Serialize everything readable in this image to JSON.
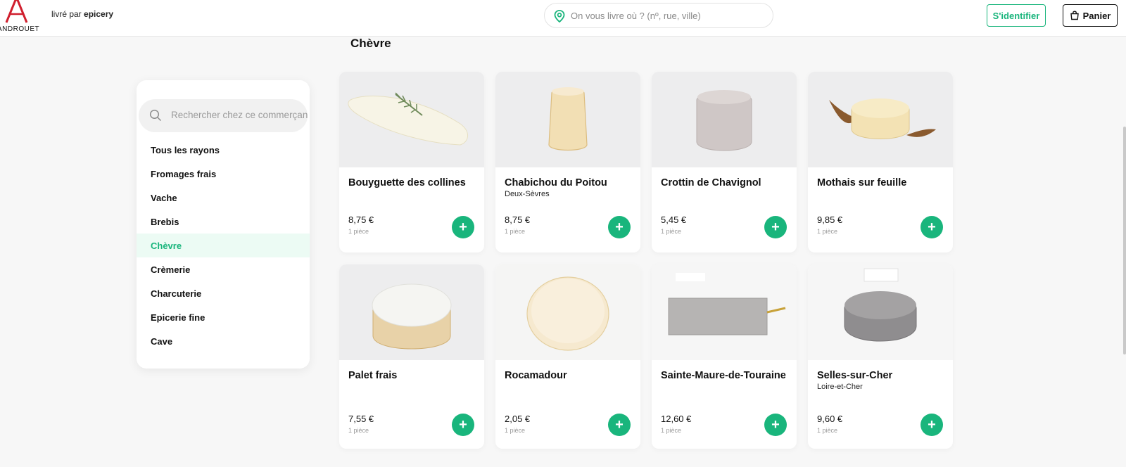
{
  "header": {
    "brand": "ANDROUET",
    "tagline_prefix": "livré par",
    "tagline_brand": "epicery",
    "address_placeholder": "On vous livre où ? (nº, rue, ville)",
    "login_label": "S'identifier",
    "cart_label": "Panier"
  },
  "section_title": "Chèvre",
  "sidebar": {
    "search_placeholder": "Rechercher chez ce commerçant",
    "categories": [
      {
        "label": "Tous les rayons"
      },
      {
        "label": "Fromages frais"
      },
      {
        "label": "Vache"
      },
      {
        "label": "Brebis"
      },
      {
        "label": "Chèvre",
        "active": true
      },
      {
        "label": "Crèmerie"
      },
      {
        "label": "Charcuterie"
      },
      {
        "label": "Epicerie fine"
      },
      {
        "label": "Cave"
      }
    ]
  },
  "products": [
    {
      "name": "Bouyguette des collines",
      "origin": "",
      "price": "8,75 €",
      "unit": "1 pièce"
    },
    {
      "name": "Chabichou du Poitou",
      "origin": "Deux-Sèvres",
      "price": "8,75 €",
      "unit": "1 pièce"
    },
    {
      "name": "Crottin de Chavignol",
      "origin": "",
      "price": "5,45 €",
      "unit": "1 pièce"
    },
    {
      "name": "Mothais sur feuille",
      "origin": "",
      "price": "9,85 €",
      "unit": "1 pièce"
    },
    {
      "name": "Palet frais",
      "origin": "",
      "price": "7,55 €",
      "unit": "1 pièce"
    },
    {
      "name": "Rocamadour",
      "origin": "",
      "price": "2,05 €",
      "unit": "1 pièce"
    },
    {
      "name": "Sainte-Maure-de-Touraine",
      "origin": "",
      "price": "12,60 €",
      "unit": "1 pièce"
    },
    {
      "name": "Selles-sur-Cher",
      "origin": "Loire-et-Cher",
      "price": "9,60 €",
      "unit": "1 pièce"
    }
  ],
  "add_symbol": "+",
  "colors": {
    "accent": "#19b57c",
    "active_bg": "#ecfbf4"
  }
}
